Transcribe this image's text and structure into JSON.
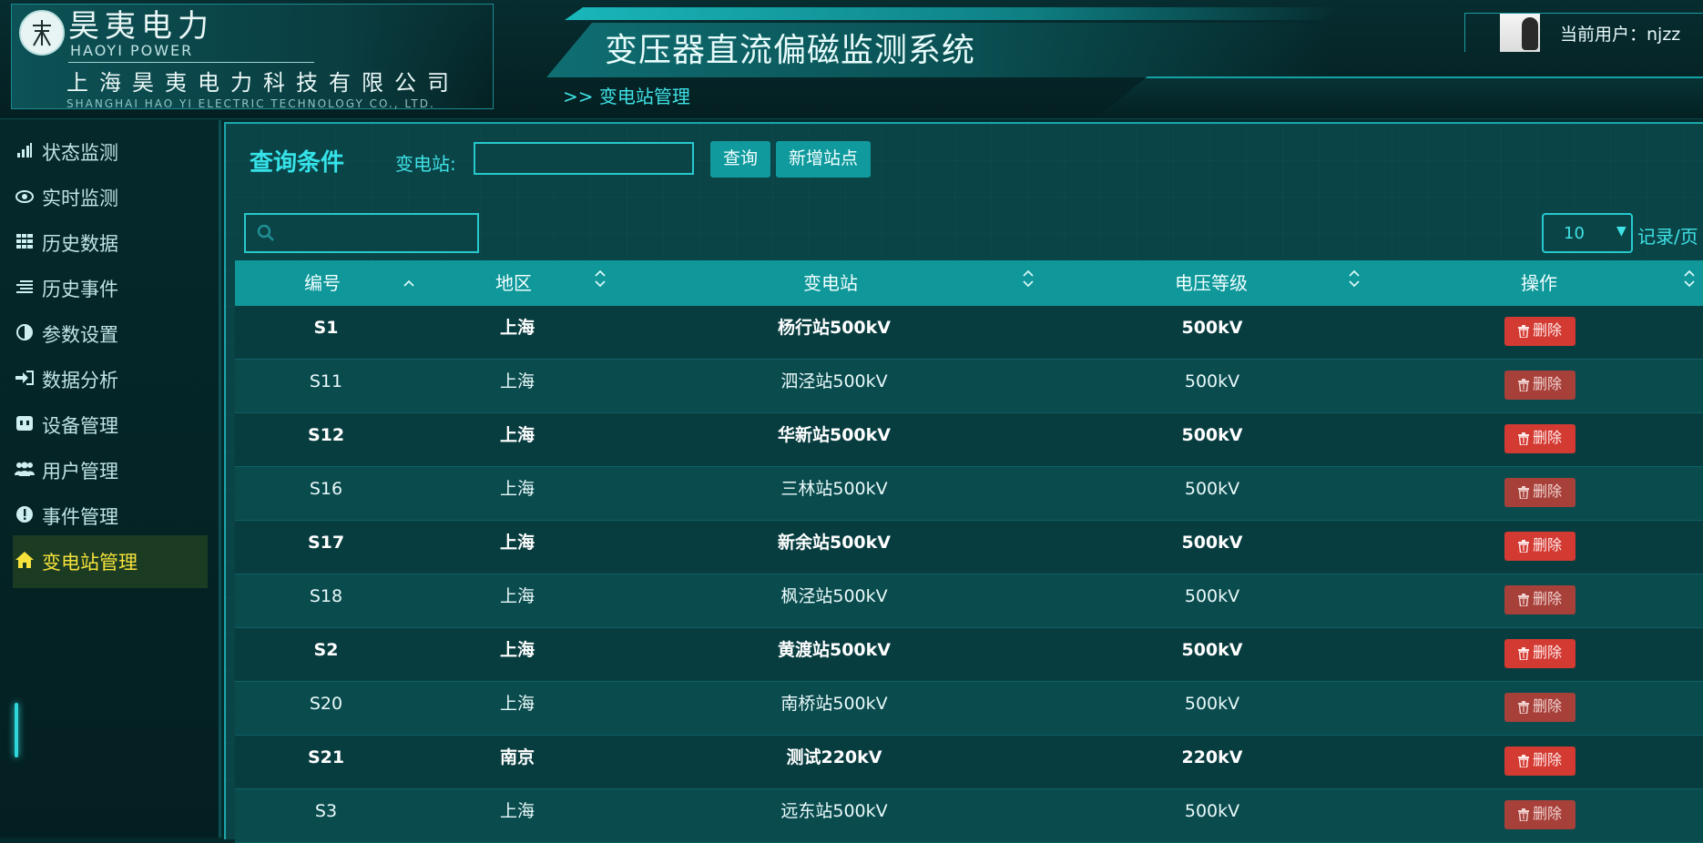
{
  "brand": {
    "name_cn": "昊夷电力",
    "name_en": "HAOYI POWER",
    "company_cn": "上海昊夷电力科技有限公司",
    "company_en": "SHANGHAI HAO YI ELECTRIC TECHNOLOGY CO., LTD."
  },
  "header": {
    "system_title": "变压器直流偏磁监测系统",
    "breadcrumb": ">> 变电站管理",
    "user_label": "当前用户：njzz"
  },
  "sidebar": {
    "items": [
      {
        "label": "状态监测",
        "icon": "bar-chart-icon"
      },
      {
        "label": "实时监测",
        "icon": "eye-icon"
      },
      {
        "label": "历史数据",
        "icon": "grid-icon"
      },
      {
        "label": "历史事件",
        "icon": "list-icon"
      },
      {
        "label": "参数设置",
        "icon": "contrast-icon"
      },
      {
        "label": "数据分析",
        "icon": "sign-in-icon"
      },
      {
        "label": "设备管理",
        "icon": "device-icon"
      },
      {
        "label": "用户管理",
        "icon": "users-icon"
      },
      {
        "label": "事件管理",
        "icon": "exclamation-icon"
      },
      {
        "label": "变电站管理",
        "icon": "home-icon",
        "active": true
      }
    ]
  },
  "query": {
    "title": "查询条件",
    "station_label": "变电站:",
    "station_value": "",
    "query_button": "查询",
    "add_button": "新增站点"
  },
  "search": {
    "value": ""
  },
  "pagination": {
    "page_size": "10",
    "unit": "记录/页"
  },
  "table": {
    "columns": [
      "编号",
      "地区",
      "变电站",
      "电压等级",
      "操作"
    ],
    "delete_label": "删除",
    "rows": [
      {
        "id": "S1",
        "region": "上海",
        "station": "杨行站500kV",
        "voltage": "500kV"
      },
      {
        "id": "S11",
        "region": "上海",
        "station": "泗泾站500kV",
        "voltage": "500kV"
      },
      {
        "id": "S12",
        "region": "上海",
        "station": "华新站500kV",
        "voltage": "500kV"
      },
      {
        "id": "S16",
        "region": "上海",
        "station": "三林站500kV",
        "voltage": "500kV"
      },
      {
        "id": "S17",
        "region": "上海",
        "station": "新余站500kV",
        "voltage": "500kV"
      },
      {
        "id": "S18",
        "region": "上海",
        "station": "枫泾站500kV",
        "voltage": "500kV"
      },
      {
        "id": "S2",
        "region": "上海",
        "station": "黄渡站500kV",
        "voltage": "500kV"
      },
      {
        "id": "S20",
        "region": "上海",
        "station": "南桥站500kV",
        "voltage": "500kV"
      },
      {
        "id": "S21",
        "region": "南京",
        "station": "测试220kV",
        "voltage": "220kV"
      },
      {
        "id": "S3",
        "region": "上海",
        "station": "远东站500kV",
        "voltage": "500kV"
      }
    ]
  },
  "colors": {
    "accent": "#35e2e8",
    "header_row": "#0f979a",
    "delete": "#d23a32",
    "active_nav": "#f6e23a"
  }
}
